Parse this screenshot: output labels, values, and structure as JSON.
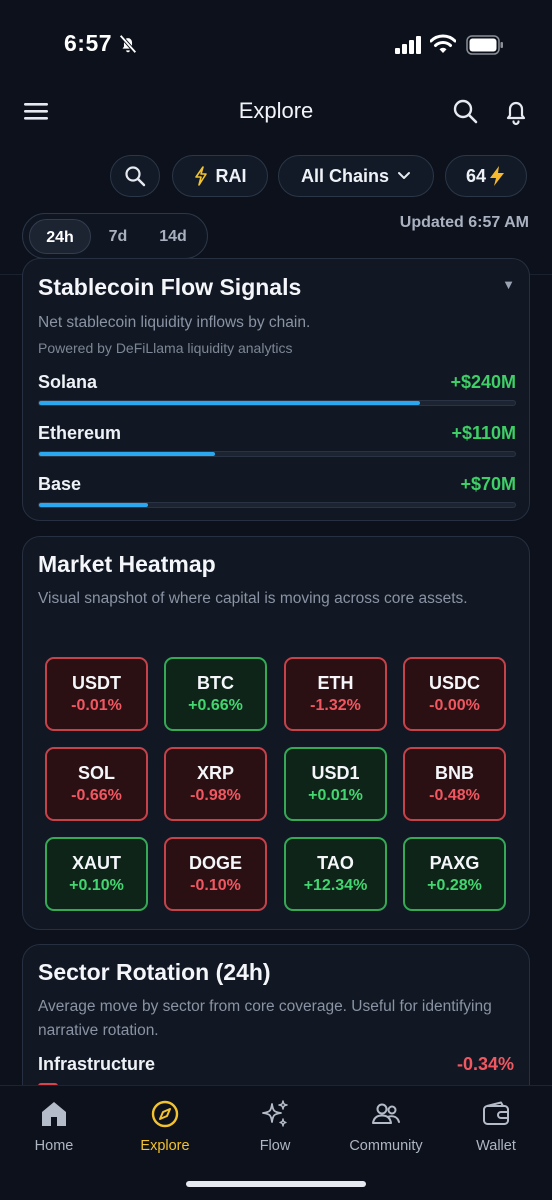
{
  "status": {
    "time": "6:57"
  },
  "header": {
    "title": "Explore"
  },
  "filters": {
    "rai_label": "RAI",
    "chains_label": "All Chains",
    "credits_label": "64"
  },
  "range": {
    "tabs": [
      "24h",
      "7d",
      "14d"
    ],
    "active": "24h"
  },
  "updated": "Updated 6:57 AM",
  "stablecoin": {
    "title": "Stablecoin Flow Signals",
    "subtitle": "Net stablecoin liquidity inflows by chain.",
    "powered_by": "Powered by DeFiLlama liquidity analytics",
    "rows": [
      {
        "name": "Solana",
        "value": "+$240M",
        "fill_pct": 80
      },
      {
        "name": "Ethereum",
        "value": "+$110M",
        "fill_pct": 37
      },
      {
        "name": "Base",
        "value": "+$70M",
        "fill_pct": 23
      }
    ]
  },
  "heatmap": {
    "title": "Market Heatmap",
    "subtitle": "Visual snapshot of where capital is moving across core assets.",
    "tiles": [
      {
        "symbol": "USDT",
        "change": "-0.01%",
        "direction": "neg"
      },
      {
        "symbol": "BTC",
        "change": "+0.66%",
        "direction": "pos"
      },
      {
        "symbol": "ETH",
        "change": "-1.32%",
        "direction": "neg"
      },
      {
        "symbol": "USDC",
        "change": "-0.00%",
        "direction": "neg"
      },
      {
        "symbol": "SOL",
        "change": "-0.66%",
        "direction": "neg"
      },
      {
        "symbol": "XRP",
        "change": "-0.98%",
        "direction": "neg"
      },
      {
        "symbol": "USD1",
        "change": "+0.01%",
        "direction": "pos"
      },
      {
        "symbol": "BNB",
        "change": "-0.48%",
        "direction": "neg"
      },
      {
        "symbol": "XAUT",
        "change": "+0.10%",
        "direction": "pos"
      },
      {
        "symbol": "DOGE",
        "change": "-0.10%",
        "direction": "neg"
      },
      {
        "symbol": "TAO",
        "change": "+12.34%",
        "direction": "pos"
      },
      {
        "symbol": "PAXG",
        "change": "+0.28%",
        "direction": "pos"
      }
    ]
  },
  "sector": {
    "title": "Sector Rotation (24h)",
    "subtitle": "Average move by sector from core coverage. Useful for identifying narrative rotation.",
    "first_row": {
      "name": "Infrastructure",
      "value": "-0.34%"
    }
  },
  "nav": {
    "items": [
      {
        "label": "Home",
        "icon": "home-icon"
      },
      {
        "label": "Explore",
        "icon": "compass-icon"
      },
      {
        "label": "Flow",
        "icon": "sparkle-icon"
      },
      {
        "label": "Community",
        "icon": "people-icon"
      },
      {
        "label": "Wallet",
        "icon": "wallet-icon"
      }
    ],
    "active": "Explore"
  },
  "colors": {
    "background": "#0c111b",
    "accent": "#f3c22f",
    "positive": "#43d56f",
    "negative": "#f05761",
    "flow_bar": "#2aa7ee"
  }
}
